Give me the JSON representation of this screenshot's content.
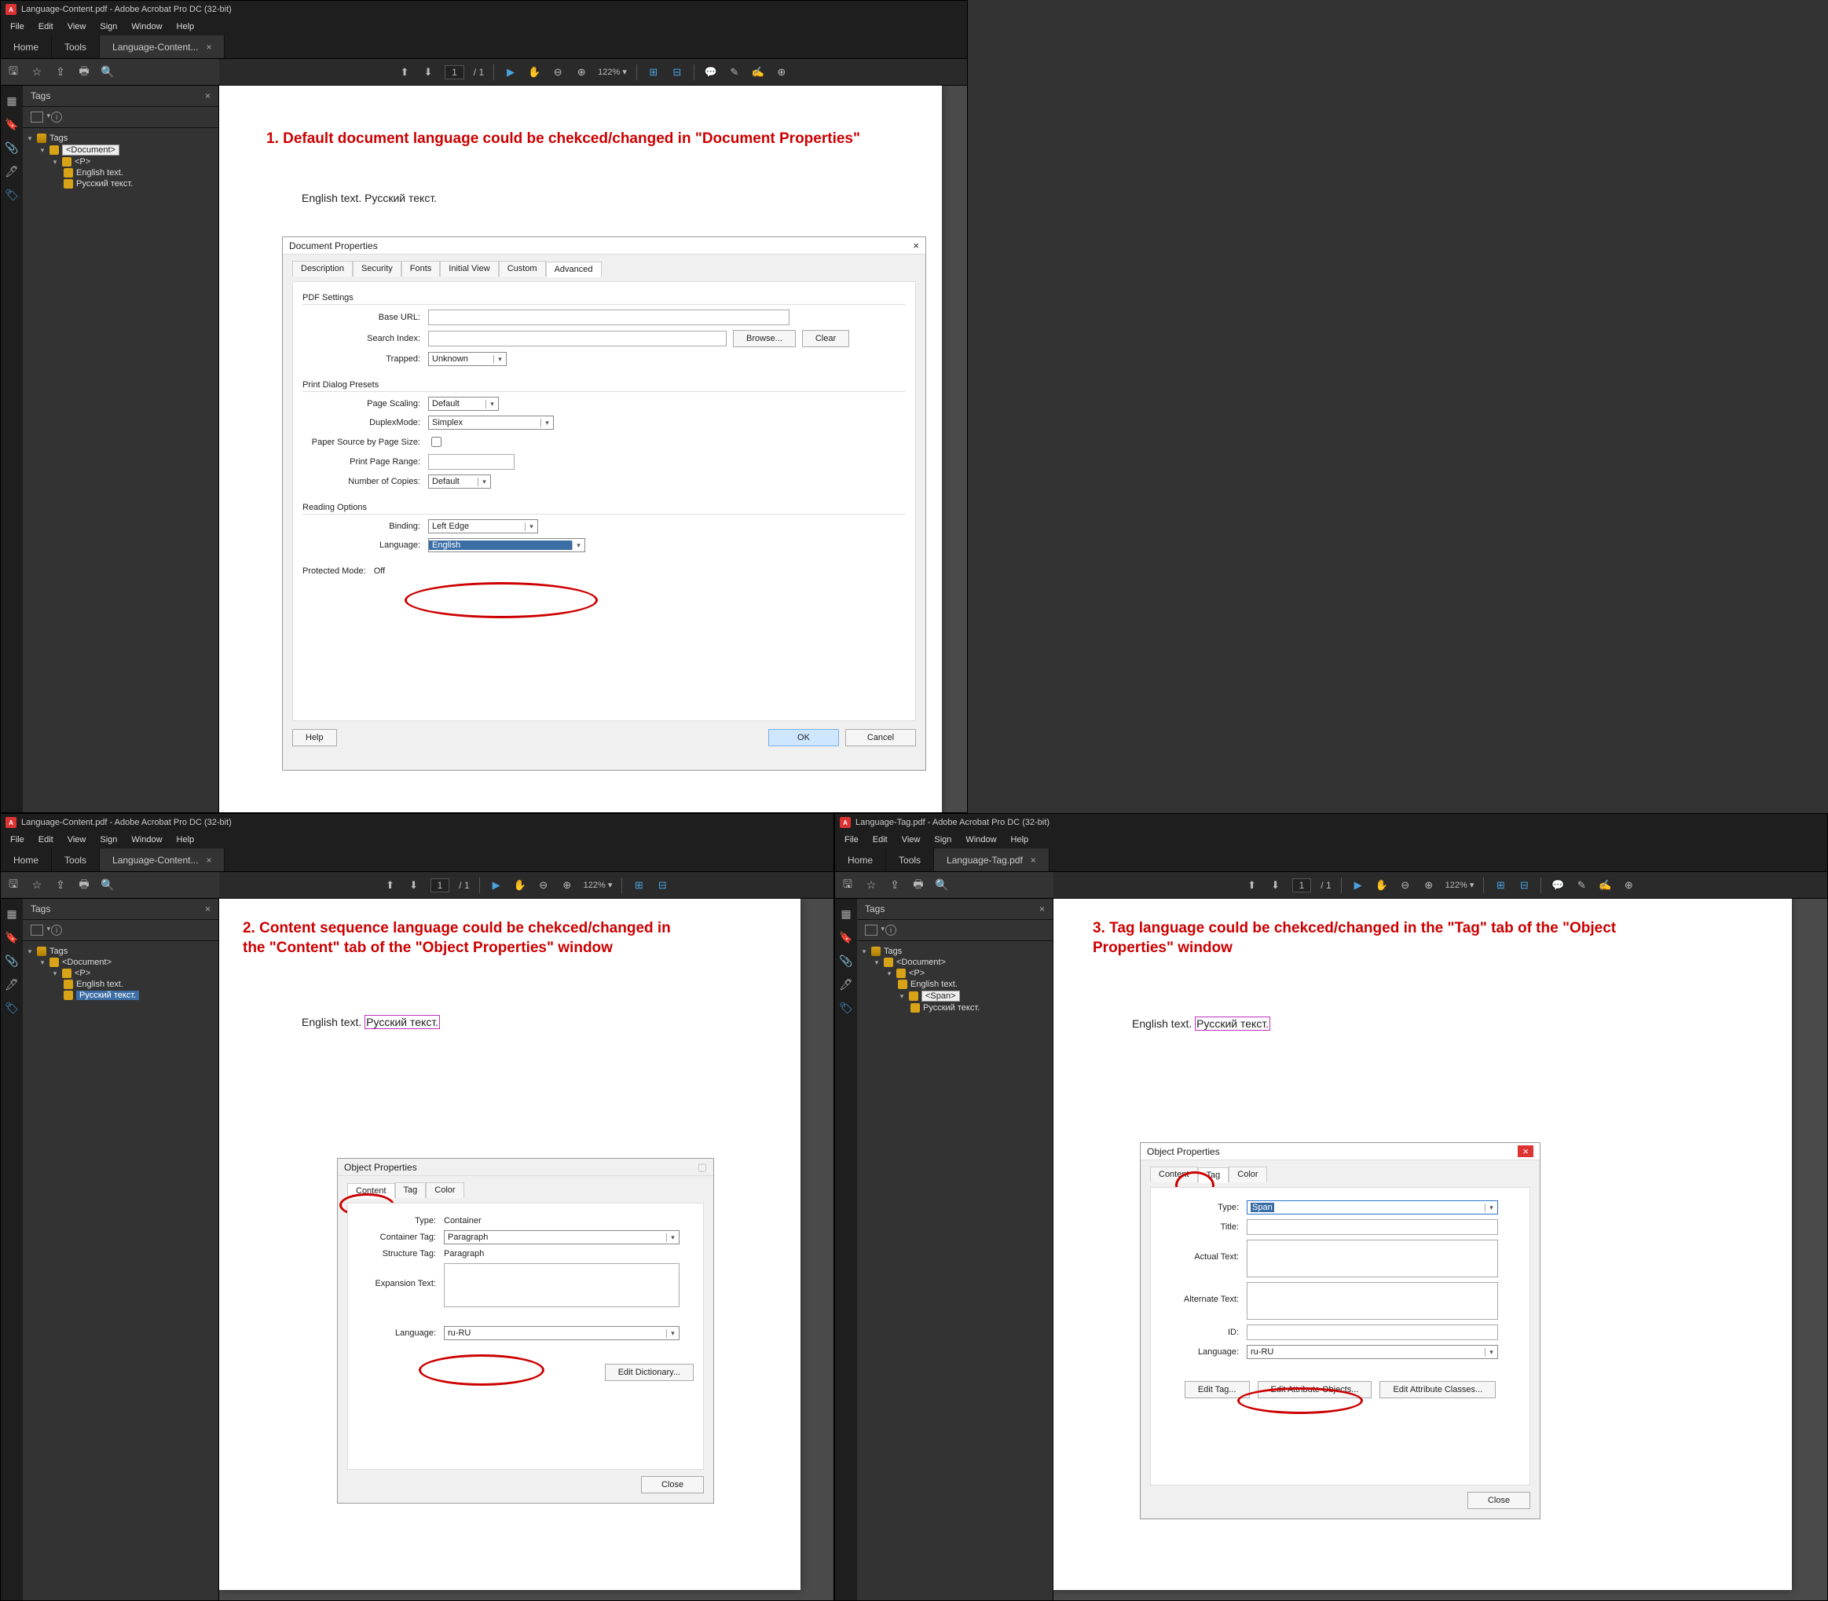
{
  "app": {
    "titlebar_top": "Language-Content.pdf - Adobe Acrobat Pro DC (32-bit)",
    "titlebar_bl": "Language-Content.pdf - Adobe Acrobat Pro DC (32-bit)",
    "titlebar_br": "Language-Tag.pdf - Adobe Acrobat Pro DC (32-bit)",
    "icon_letter": "A"
  },
  "menu": {
    "file": "File",
    "edit": "Edit",
    "view": "View",
    "sign": "Sign",
    "window": "Window",
    "help": "Help"
  },
  "tabs": {
    "home": "Home",
    "tools": "Tools",
    "doc_top": "Language-Content...",
    "doc_bl": "Language-Content...",
    "doc_br": "Language-Tag.pdf",
    "close": "×"
  },
  "toolbar": {
    "page": "1",
    "pages": "/ 1",
    "zoom": "122%",
    "arrow": "▾"
  },
  "side": {
    "panel_title": "Tags",
    "close": "×",
    "info": "i"
  },
  "tree_top": {
    "root": "Tags",
    "doc": "<Document>",
    "p": "<P>",
    "leaf1": "English text.",
    "leaf2": "Русский текст."
  },
  "tree_bl": {
    "root": "Tags",
    "doc": "<Document>",
    "p": "<P>",
    "leaf1": "English text.",
    "leaf2": "Русский текст."
  },
  "tree_br": {
    "root": "Tags",
    "doc": "<Document>",
    "p": "<P>",
    "span": "<Span>",
    "leaf1": "English text.",
    "leaf2": "Русский текст."
  },
  "captions": {
    "c1": "1. Default document language could be chekced/changed in \"Document Properties\"",
    "c2": "2. Content sequence language could be chekced/changed in the \"Content\" tab of the \"Object Properties\" window",
    "c3": "3. Tag language could be chekced/changed in the \"Tag\" tab of the \"Object Properties\" window"
  },
  "doc_text": {
    "english": "English text.",
    "space": " ",
    "russian": "Русский текст."
  },
  "docprops": {
    "title": "Document Properties",
    "close": "×",
    "tabs": {
      "description": "Description",
      "security": "Security",
      "fonts": "Fonts",
      "initial": "Initial View",
      "custom": "Custom",
      "advanced": "Advanced"
    },
    "pdf_settings": "PDF Settings",
    "base_url": "Base URL:",
    "search_index": "Search Index:",
    "browse": "Browse...",
    "clear": "Clear",
    "trapped": "Trapped:",
    "trapped_v": "Unknown",
    "print_presets": "Print Dialog Presets",
    "page_scaling": "Page Scaling:",
    "page_scaling_v": "Default",
    "duplex": "DuplexMode:",
    "duplex_v": "Simplex",
    "paper_src": "Paper Source by Page Size:",
    "page_range": "Print Page Range:",
    "copies": "Number of Copies:",
    "copies_v": "Default",
    "reading": "Reading Options",
    "binding": "Binding:",
    "binding_v": "Left Edge",
    "language": "Language:",
    "language_v": "English",
    "protected": "Protected Mode:",
    "protected_v": "Off",
    "help": "Help",
    "ok": "OK",
    "cancel": "Cancel"
  },
  "objprops": {
    "title": "Object Properties",
    "close": "×",
    "tabs": {
      "content": "Content",
      "tag": "Tag",
      "color": "Color"
    },
    "content": {
      "type_l": "Type:",
      "type_v": "Container",
      "ctag_l": "Container Tag:",
      "ctag_v": "Paragraph",
      "stag_l": "Structure Tag:",
      "stag_v": "Paragraph",
      "exp_l": "Expansion Text:",
      "lang_l": "Language:",
      "lang_v": "ru-RU",
      "edit_dict": "Edit Dictionary...",
      "close_btn": "Close"
    },
    "tag": {
      "type_l": "Type:",
      "type_v": "Span",
      "title_l": "Title:",
      "actual_l": "Actual Text:",
      "alt_l": "Alternate Text:",
      "id_l": "ID:",
      "lang_l": "Language:",
      "lang_v": "ru-RU",
      "edit_tag": "Edit Tag...",
      "edit_attr_obj": "Edit Attribute Objects...",
      "edit_attr_cls": "Edit Attribute Classes...",
      "close_btn": "Close"
    }
  }
}
